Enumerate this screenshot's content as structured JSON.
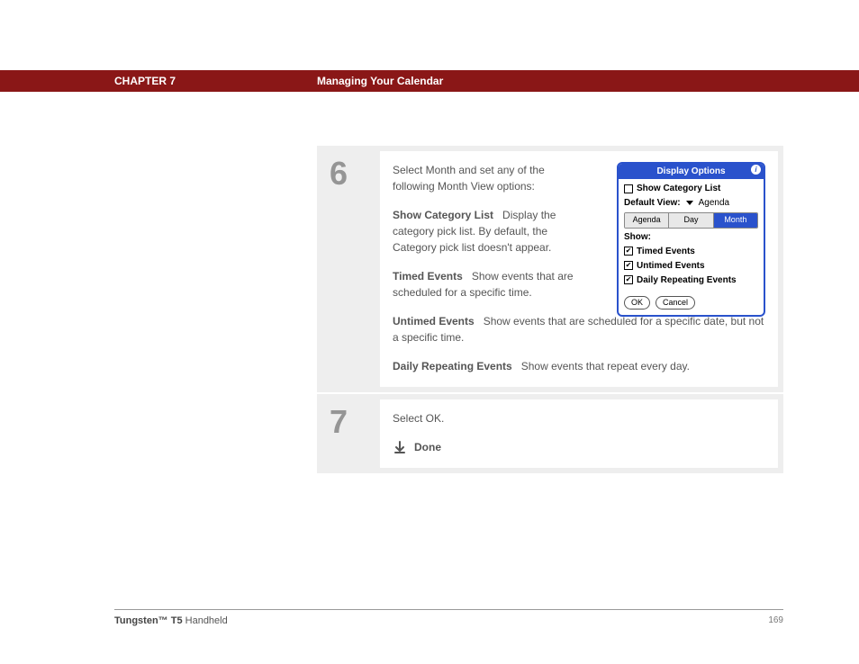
{
  "header": {
    "chapter": "CHAPTER 7",
    "title": "Managing Your Calendar"
  },
  "step6": {
    "number": "6",
    "intro": "Select Month and set any of the following Month View options:",
    "options": [
      {
        "label": "Show Category List",
        "desc": "Display the category pick list. By default, the Category pick list doesn't appear."
      },
      {
        "label": "Timed Events",
        "desc": "Show events that are scheduled for a specific time."
      },
      {
        "label": "Untimed Events",
        "desc": "Show events that are scheduled for a specific date, but not a specific time."
      },
      {
        "label": "Daily Repeating Events",
        "desc": "Show events that repeat every day."
      }
    ]
  },
  "dialog": {
    "title": "Display Options",
    "show_category_list": "Show Category List",
    "default_view_label": "Default View:",
    "default_view_value": "Agenda",
    "tabs": {
      "agenda": "Agenda",
      "day": "Day",
      "month": "Month"
    },
    "show_label": "Show:",
    "checks": {
      "timed": "Timed Events",
      "untimed": "Untimed Events",
      "daily": "Daily Repeating Events"
    },
    "buttons": {
      "ok": "OK",
      "cancel": "Cancel"
    }
  },
  "step7": {
    "number": "7",
    "text": "Select OK.",
    "done": "Done"
  },
  "footer": {
    "model_bold": "Tungsten™ T5",
    "model_rest": " Handheld",
    "page": "169"
  }
}
